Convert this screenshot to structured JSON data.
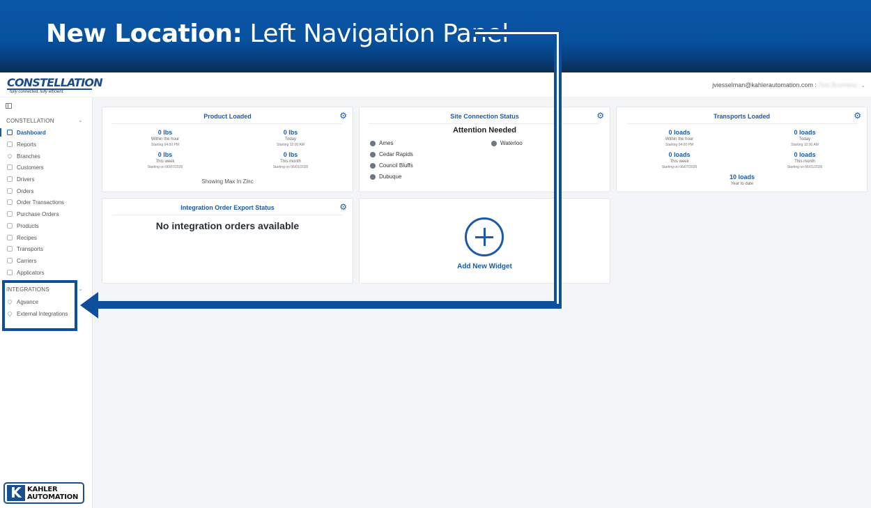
{
  "banner": {
    "title_bold": "New Location:",
    "title_rest": " Left Navigation Panel"
  },
  "header": {
    "logo_main": "CONSTELLATION",
    "logo_tagline": "fully connected. fully efficient.",
    "user_email": "jviesselman@kahlerautomation.com :",
    "business": "Test Business"
  },
  "sidebar": {
    "section_constellation": "CONSTELLATION",
    "items": [
      {
        "label": "Dashboard",
        "icon": "dashboard-icon"
      },
      {
        "label": "Reports",
        "icon": "report-icon"
      },
      {
        "label": "Branches",
        "icon": "location-icon"
      },
      {
        "label": "Customers",
        "icon": "users-icon"
      },
      {
        "label": "Drivers",
        "icon": "users-icon"
      },
      {
        "label": "Orders",
        "icon": "clipboard-icon"
      },
      {
        "label": "Order Transactions",
        "icon": "document-icon"
      },
      {
        "label": "Purchase Orders",
        "icon": "document-icon"
      },
      {
        "label": "Products",
        "icon": "boxes-icon"
      },
      {
        "label": "Recipes",
        "icon": "flask-icon"
      },
      {
        "label": "Transports",
        "icon": "truck-icon"
      },
      {
        "label": "Carriers",
        "icon": "truck-icon"
      },
      {
        "label": "Applicators",
        "icon": "tractor-icon"
      }
    ],
    "section_integrations": "INTEGRATIONS",
    "integration_items": [
      {
        "label": "Agvance",
        "icon": "pin-icon"
      },
      {
        "label": "External Integrations",
        "icon": "pin-icon"
      }
    ]
  },
  "footer_logo": {
    "mark": "K",
    "line1": "KAHLER",
    "line2": "AUTOMATION"
  },
  "widgets": {
    "product_loaded": {
      "title": "Product Loaded",
      "stats": [
        {
          "value": "0 lbs",
          "label": "Within the hour",
          "sub": "Starting 04:00 PM"
        },
        {
          "value": "0 lbs",
          "label": "Today",
          "sub": "Starting 12:00 AM"
        },
        {
          "value": "0 lbs",
          "label": "This week",
          "sub": "Starting on 06/07/2026"
        },
        {
          "value": "0 lbs",
          "label": "This month",
          "sub": "Starting on 06/01/2026"
        }
      ],
      "note": "Showing Max In Zinc"
    },
    "site_connection": {
      "title": "Site Connection Status",
      "attention": "Attention Needed",
      "sites": [
        "Ames",
        "Cedar Rapids",
        "Council Bluffs",
        "Dubuque",
        "Waterloo"
      ]
    },
    "transports_loaded": {
      "title": "Transports Loaded",
      "stats": [
        {
          "value": "0 loads",
          "label": "Within the hour",
          "sub": "Starting 04:00 PM"
        },
        {
          "value": "0 loads",
          "label": "Today",
          "sub": "Starting 12:00 AM"
        },
        {
          "value": "0 loads",
          "label": "This week",
          "sub": "Starting on 06/07/2026"
        },
        {
          "value": "0 loads",
          "label": "This month",
          "sub": "Starting on 06/01/2026"
        },
        {
          "value": "10 loads",
          "label": "Year to date",
          "sub": ""
        }
      ]
    },
    "integration_export": {
      "title": "Integration Order Export Status",
      "message": "No integration orders available"
    },
    "add_widget": {
      "label": "Add New Widget"
    }
  },
  "colors": {
    "brand_blue": "#1a5aa6",
    "banner_blue": "#0a57a8",
    "highlight": "#0d4f9b"
  }
}
